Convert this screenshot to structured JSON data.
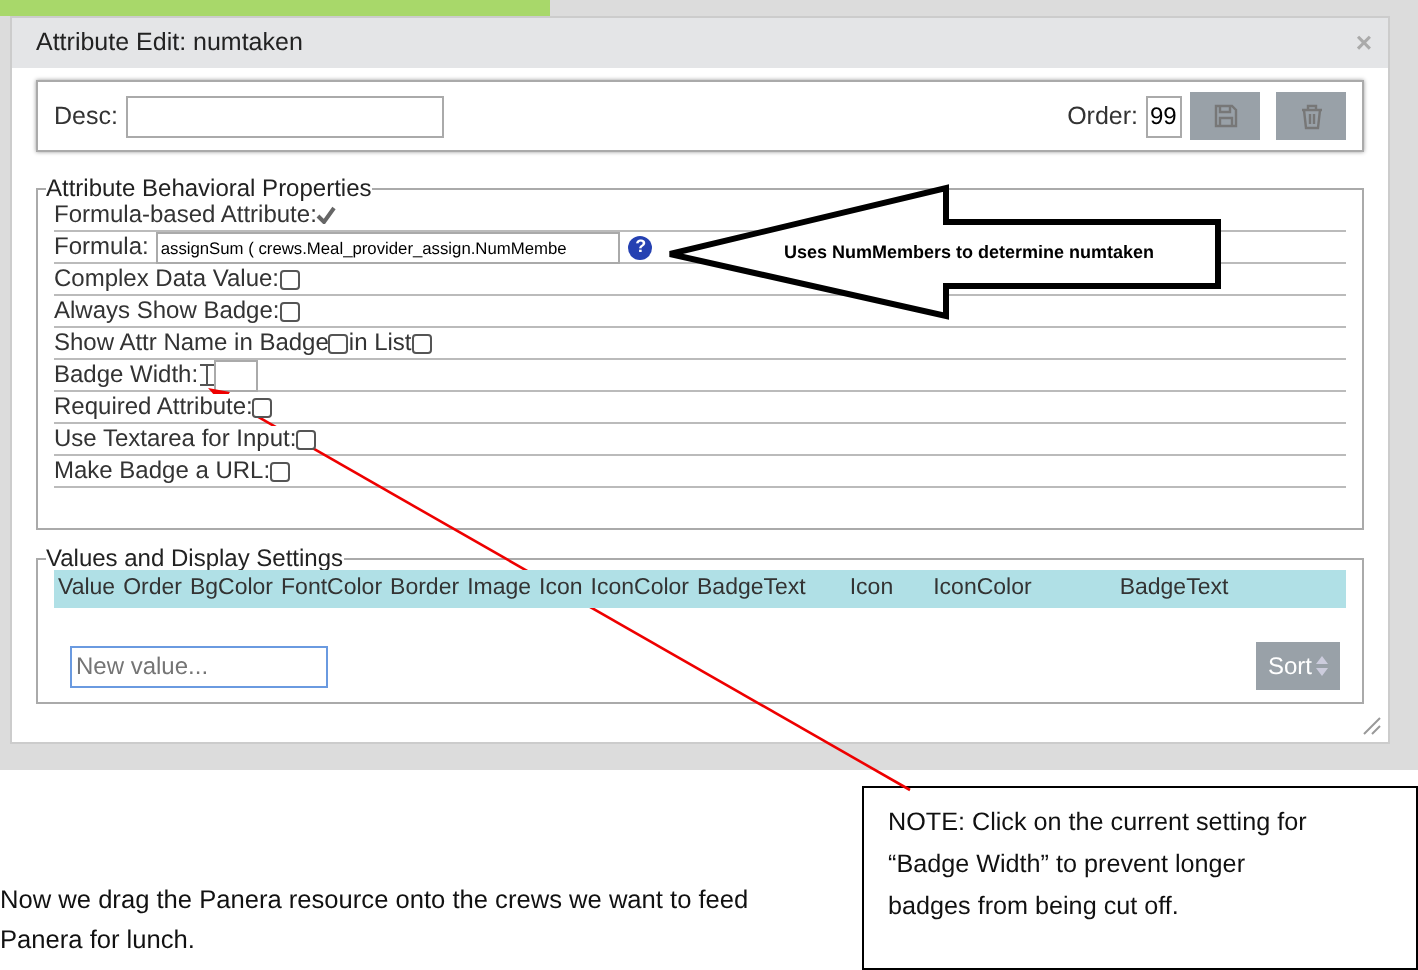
{
  "dialog": {
    "title": "Attribute Edit: numtaken",
    "close": "×",
    "desc": {
      "label": "Desc:"
    },
    "order": {
      "label": "Order:",
      "value": "99"
    },
    "behavior": {
      "legend": "Attribute Behavioral Properties",
      "rows": [
        {
          "kind": "mark",
          "label": "Formula-based Attribute:",
          "checked": true
        },
        {
          "kind": "input",
          "label": "Formula:",
          "value": "assignSum ( crews.Meal_provider_assign.NumMembe",
          "help": "?"
        },
        {
          "kind": "check",
          "label": "Complex Data Value:",
          "checked": false
        },
        {
          "kind": "check",
          "label": "Always Show Badge:",
          "checked": false
        },
        {
          "kind": "pair",
          "label": "Show Attr Name in Badge",
          "checked": false,
          "label2": "in List",
          "checked2": false
        },
        {
          "kind": "number",
          "label": "Badge Width:",
          "value": ""
        },
        {
          "kind": "check",
          "label": "Required Attribute:",
          "checked": false
        },
        {
          "kind": "check",
          "label": "Use Textarea for Input:",
          "checked": false
        },
        {
          "kind": "check",
          "label": "Make Badge a URL:",
          "checked": false
        }
      ]
    },
    "values": {
      "legend": "Values and Display Settings",
      "columns": [
        "Value",
        "Order",
        "BgColor",
        "FontColor",
        "Border",
        "Image",
        "Icon",
        "IconColor",
        "BadgeText",
        "Icon",
        "IconColor",
        "BadgeText"
      ],
      "placeholder": "New value...",
      "sort": "Sort"
    }
  },
  "callout": "Uses NumMembers to determine numtaken",
  "paragraph": "Now we drag the Panera resource onto the crews we want to feed Panera for lunch.",
  "note": "NOTE:  Click on the current setting for “Badge Width” to prevent longer badges from being cut off."
}
